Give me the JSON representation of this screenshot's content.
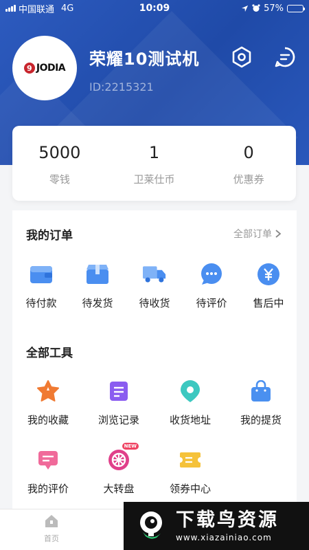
{
  "status_bar": {
    "carrier": "中国联通",
    "network": "4G",
    "time": "10:09",
    "battery": "57%",
    "battery_level": 0.57
  },
  "profile": {
    "logo_badge": "9",
    "logo_text": "JODIA",
    "name": "荣耀10测试机",
    "id": "ID:2215321",
    "settings_icon": "settings-hexagon-icon",
    "message_icon": "message-icon"
  },
  "wallet": [
    {
      "value": "5000",
      "label": "零钱"
    },
    {
      "value": "1",
      "label": "卫莱仕币"
    },
    {
      "value": "0",
      "label": "优惠券"
    }
  ],
  "orders": {
    "title": "我的订单",
    "all_label": "全部订单",
    "items": [
      {
        "label": "待付款",
        "icon": "wallet-icon"
      },
      {
        "label": "待发货",
        "icon": "package-icon"
      },
      {
        "label": "待收货",
        "icon": "truck-icon"
      },
      {
        "label": "待评价",
        "icon": "chat-bubble-icon"
      },
      {
        "label": "售后中",
        "icon": "yen-icon"
      }
    ]
  },
  "tools": {
    "title": "全部工具",
    "items": [
      {
        "label": "我的收藏",
        "icon": "star-icon"
      },
      {
        "label": "浏览记录",
        "icon": "history-icon"
      },
      {
        "label": "收货地址",
        "icon": "location-pin-icon"
      },
      {
        "label": "我的提货",
        "icon": "shopping-bag-icon"
      },
      {
        "label": "我的评价",
        "icon": "comment-icon"
      },
      {
        "label": "大转盘",
        "icon": "wheel-icon",
        "badge": "NEW"
      },
      {
        "label": "领券中心",
        "icon": "coupon-icon"
      }
    ]
  },
  "bottom_nav": {
    "home_label": "首页"
  },
  "watermark": {
    "title": "下载鸟资源",
    "url": "www.xiazainiao.com"
  },
  "colors": {
    "header_blue": "#2b56b9",
    "order_icon_blue": "#4a8ef0",
    "tool_orange": "#f07a32",
    "tool_purple": "#8a5cf0",
    "tool_teal": "#3cc8c0",
    "tool_bluebag": "#4a90f0",
    "tool_pink": "#f06a9a",
    "tool_magenta": "#e0408a",
    "tool_yellow": "#f5c23a"
  }
}
